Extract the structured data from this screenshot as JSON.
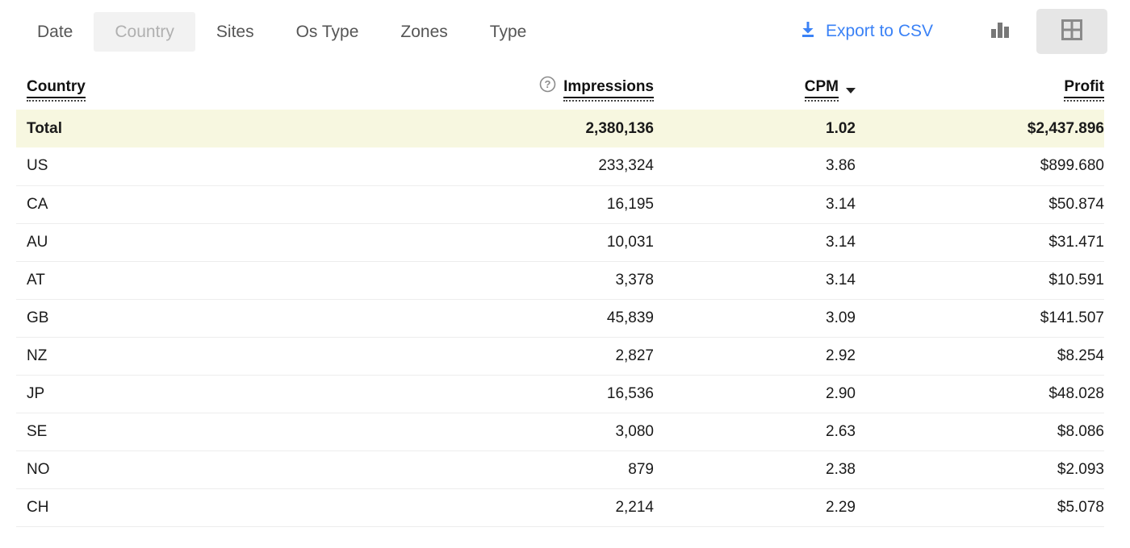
{
  "toolbar": {
    "tabs": [
      {
        "label": "Date",
        "active": false
      },
      {
        "label": "Country",
        "active": true
      },
      {
        "label": "Sites",
        "active": false
      },
      {
        "label": "Os Type",
        "active": false
      },
      {
        "label": "Zones",
        "active": false
      },
      {
        "label": "Type",
        "active": false
      }
    ],
    "export_label": "Export to CSV",
    "export_icon": "download-icon",
    "chart_view_icon": "bar-chart-icon",
    "table_view_icon": "grid-table-icon",
    "accent_color": "#3b82f6",
    "active_tab_bg": "#f2f2f2",
    "active_view": "table"
  },
  "table": {
    "columns": [
      {
        "key": "country",
        "label": "Country",
        "align": "left",
        "has_help": false,
        "sorted": false
      },
      {
        "key": "impressions",
        "label": "Impressions",
        "align": "right",
        "has_help": true,
        "sorted": false
      },
      {
        "key": "cpm",
        "label": "CPM",
        "align": "right",
        "has_help": false,
        "sorted": true,
        "sort_dir": "desc"
      },
      {
        "key": "profit",
        "label": "Profit",
        "align": "right",
        "has_help": false,
        "sorted": false
      }
    ],
    "help_icon": "question-circle-icon",
    "total_row": {
      "country": "Total",
      "impressions": "2,380,136",
      "cpm": "1.02",
      "profit": "$2,437.896",
      "highlight_color": "#f7f7e0"
    },
    "rows": [
      {
        "country": "US",
        "impressions": "233,324",
        "cpm": "3.86",
        "profit": "$899.680"
      },
      {
        "country": "CA",
        "impressions": "16,195",
        "cpm": "3.14",
        "profit": "$50.874"
      },
      {
        "country": "AU",
        "impressions": "10,031",
        "cpm": "3.14",
        "profit": "$31.471"
      },
      {
        "country": "AT",
        "impressions": "3,378",
        "cpm": "3.14",
        "profit": "$10.591"
      },
      {
        "country": "GB",
        "impressions": "45,839",
        "cpm": "3.09",
        "profit": "$141.507"
      },
      {
        "country": "NZ",
        "impressions": "2,827",
        "cpm": "2.92",
        "profit": "$8.254"
      },
      {
        "country": "JP",
        "impressions": "16,536",
        "cpm": "2.90",
        "profit": "$48.028"
      },
      {
        "country": "SE",
        "impressions": "3,080",
        "cpm": "2.63",
        "profit": "$8.086"
      },
      {
        "country": "NO",
        "impressions": "879",
        "cpm": "2.38",
        "profit": "$2.093"
      },
      {
        "country": "CH",
        "impressions": "2,214",
        "cpm": "2.29",
        "profit": "$5.078"
      }
    ]
  }
}
